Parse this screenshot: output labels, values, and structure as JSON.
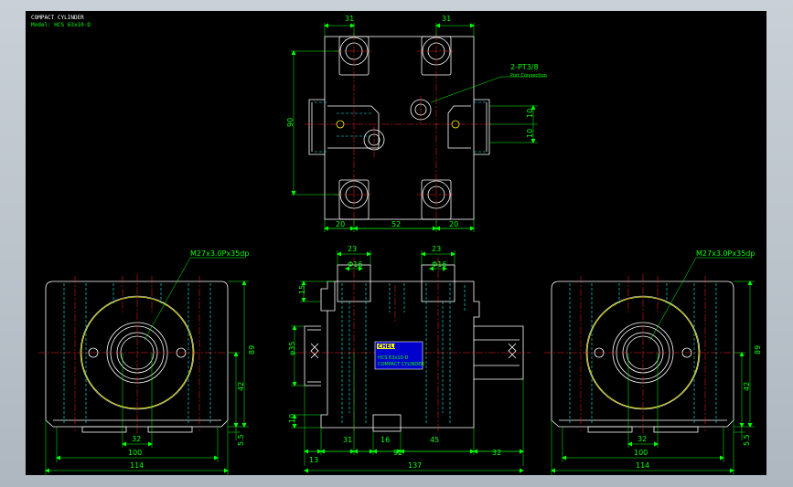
{
  "title_block": {
    "title": "COMPACT CYLINDER",
    "model": "Model: HCS 63x10-D"
  },
  "colors": {
    "background": "#000000",
    "outline": "#ffffff",
    "dimension": "#00ff00",
    "centerline": "#ff2020",
    "hidden": "#00ffff",
    "bore_circle": "#ffff00",
    "label_plate": "#0000cc"
  },
  "top_view": {
    "dims": {
      "top_left": "31",
      "top_right": "31",
      "height": "90",
      "right_a": "10",
      "right_b": "10",
      "bottom_left": "20",
      "bottom_mid": "52",
      "bottom_right": "20"
    },
    "port_label": "2-PT3/8",
    "port_sub": "Port Connection"
  },
  "left_view": {
    "thread_label": "M27x3.0Px35dp",
    "dims": {
      "height": "89",
      "mid": "42",
      "base": "5.5",
      "w_inner": "32",
      "w_mid": "100",
      "w_outer": "114"
    }
  },
  "front_view": {
    "dims": {
      "top_left": "23",
      "top_right": "23",
      "phi_left": "Φ16",
      "phi_right": "Φ16",
      "left_top": "15",
      "rod_dia": "φ35",
      "left_bottom": "10",
      "b1": "13",
      "b2": "31",
      "b3": "16",
      "b4": "45",
      "b5": "32",
      "b_mid": "92",
      "overall": "137"
    },
    "plate": {
      "brand": "CHELIC",
      "line1": "HCS 63x10-D",
      "line2": "COMPACT CYLINDER"
    }
  },
  "right_view": {
    "thread_label": "M27x3.0Px35dp",
    "dims": {
      "height": "89",
      "mid": "42",
      "base": "5.5",
      "w_inner": "32",
      "w_mid": "100",
      "w_outer": "114"
    }
  }
}
